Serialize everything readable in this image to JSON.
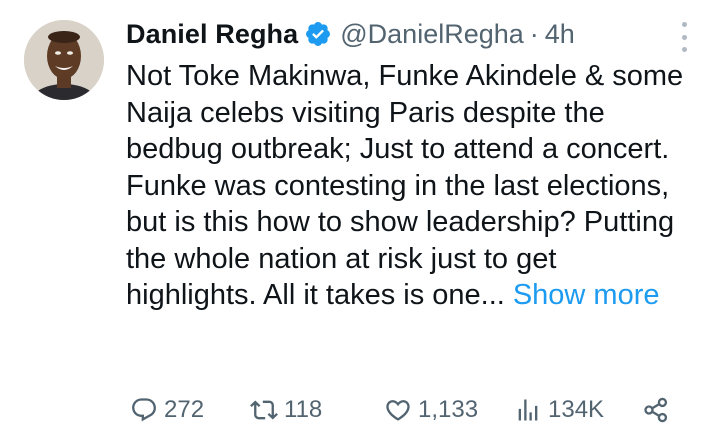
{
  "author": {
    "name": "Daniel Regha",
    "handle": "@DanielRegha",
    "separator": "·",
    "time": "4h"
  },
  "tweet": {
    "text": "Not Toke Makinwa, Funke Akindele & some Naija celebs visiting Paris despite the bedbug outbreak; Just to attend a concert. Funke was contesting in the last elections, but is this how to show leadership? Putting the whole nation at risk just to get highlights. All it takes is one...",
    "show_more": "Show more"
  },
  "actions": {
    "replies": "272",
    "retweets": "118",
    "likes": "1,133",
    "views": "134K"
  },
  "colors": {
    "accent": "#1d9bf0",
    "muted": "#536471",
    "text": "#0f1419"
  },
  "icons": [
    "verified-badge-icon",
    "more-icon",
    "reply-icon",
    "retweet-icon",
    "like-icon",
    "views-icon",
    "share-icon"
  ]
}
